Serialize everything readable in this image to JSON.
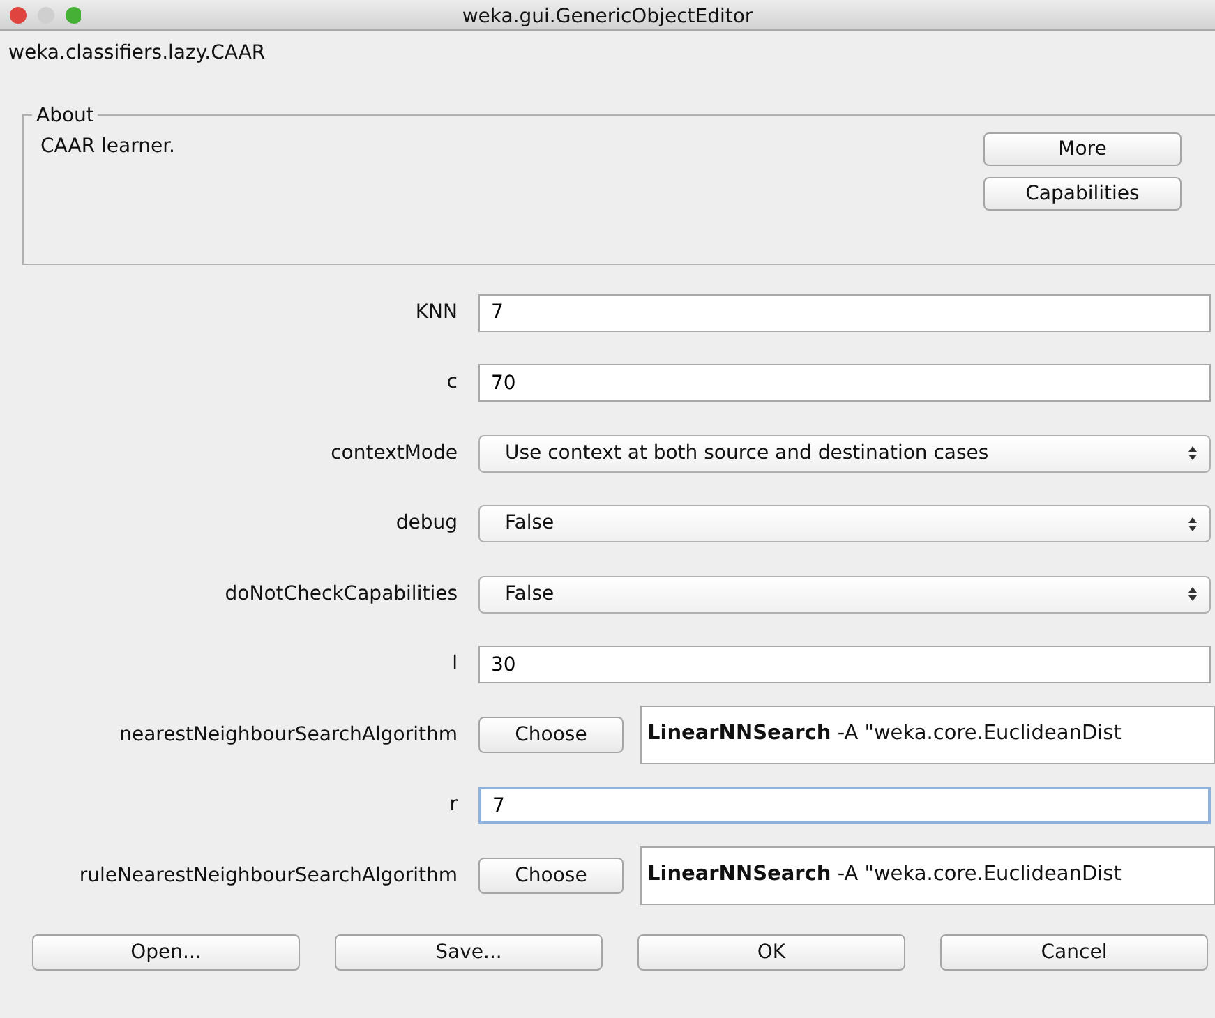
{
  "window": {
    "title": "weka.gui.GenericObjectEditor"
  },
  "class_name": "weka.classifiers.lazy.CAAR",
  "about": {
    "legend": "About",
    "text": "CAAR learner.",
    "buttons": [
      "More",
      "Capabilities"
    ]
  },
  "properties": [
    {
      "label": "KNN",
      "kind": "text",
      "value": "7",
      "focused": false
    },
    {
      "label": "c",
      "kind": "text",
      "value": "70",
      "focused": false
    },
    {
      "label": "contextMode",
      "kind": "select",
      "value": "Use context at both source and destination cases"
    },
    {
      "label": "debug",
      "kind": "select",
      "value": "False"
    },
    {
      "label": "doNotCheckCapabilities",
      "kind": "select",
      "value": "False"
    },
    {
      "label": "l",
      "kind": "text",
      "value": "30",
      "focused": false
    },
    {
      "label": "nearestNeighbourSearchAlgorithm",
      "kind": "object",
      "button": "Choose",
      "value": "**LinearNNSearch** -A \"weka.core.EuclideanDist"
    },
    {
      "label": "r",
      "kind": "text",
      "value": "7",
      "focused": true
    },
    {
      "label": "ruleNearestNeighbourSearchAlgorithm",
      "kind": "object",
      "button": "Choose",
      "value": "**LinearNNSearch** -A \"weka.core.EuclideanDist"
    }
  ],
  "buttons": [
    "Open...",
    "Save...",
    "OK",
    "Cancel"
  ]
}
